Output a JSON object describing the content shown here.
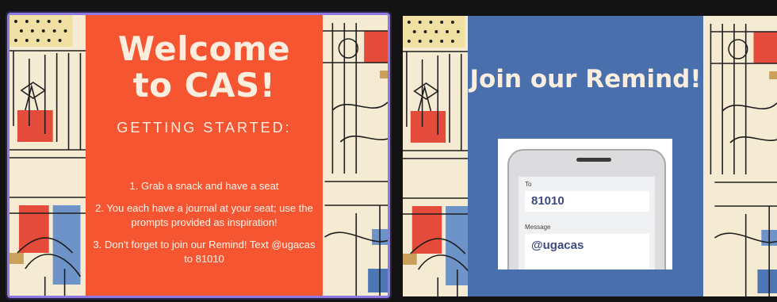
{
  "slides": [
    {
      "title": "Welcome to CAS!",
      "subtitle": "GETTING STARTED:",
      "steps": [
        "1. Grab a snack and have a seat",
        "2. You each have a journal at your seat; use the prompts provided as inspiration!",
        "3. Don't forget to join our Remind! Text @ugacas to 81010"
      ],
      "colors": {
        "card": "#f65532",
        "text": "#fbeede",
        "selection_border": "#8f79e2"
      },
      "selected": true
    },
    {
      "title": "Join our Remind!",
      "phone": {
        "to_label": "To",
        "to_value": "81010",
        "message_label": "Message",
        "message_value": "@ugacas"
      },
      "colors": {
        "card": "#4a6fad",
        "text": "#fbeede"
      },
      "selected": false
    }
  ]
}
